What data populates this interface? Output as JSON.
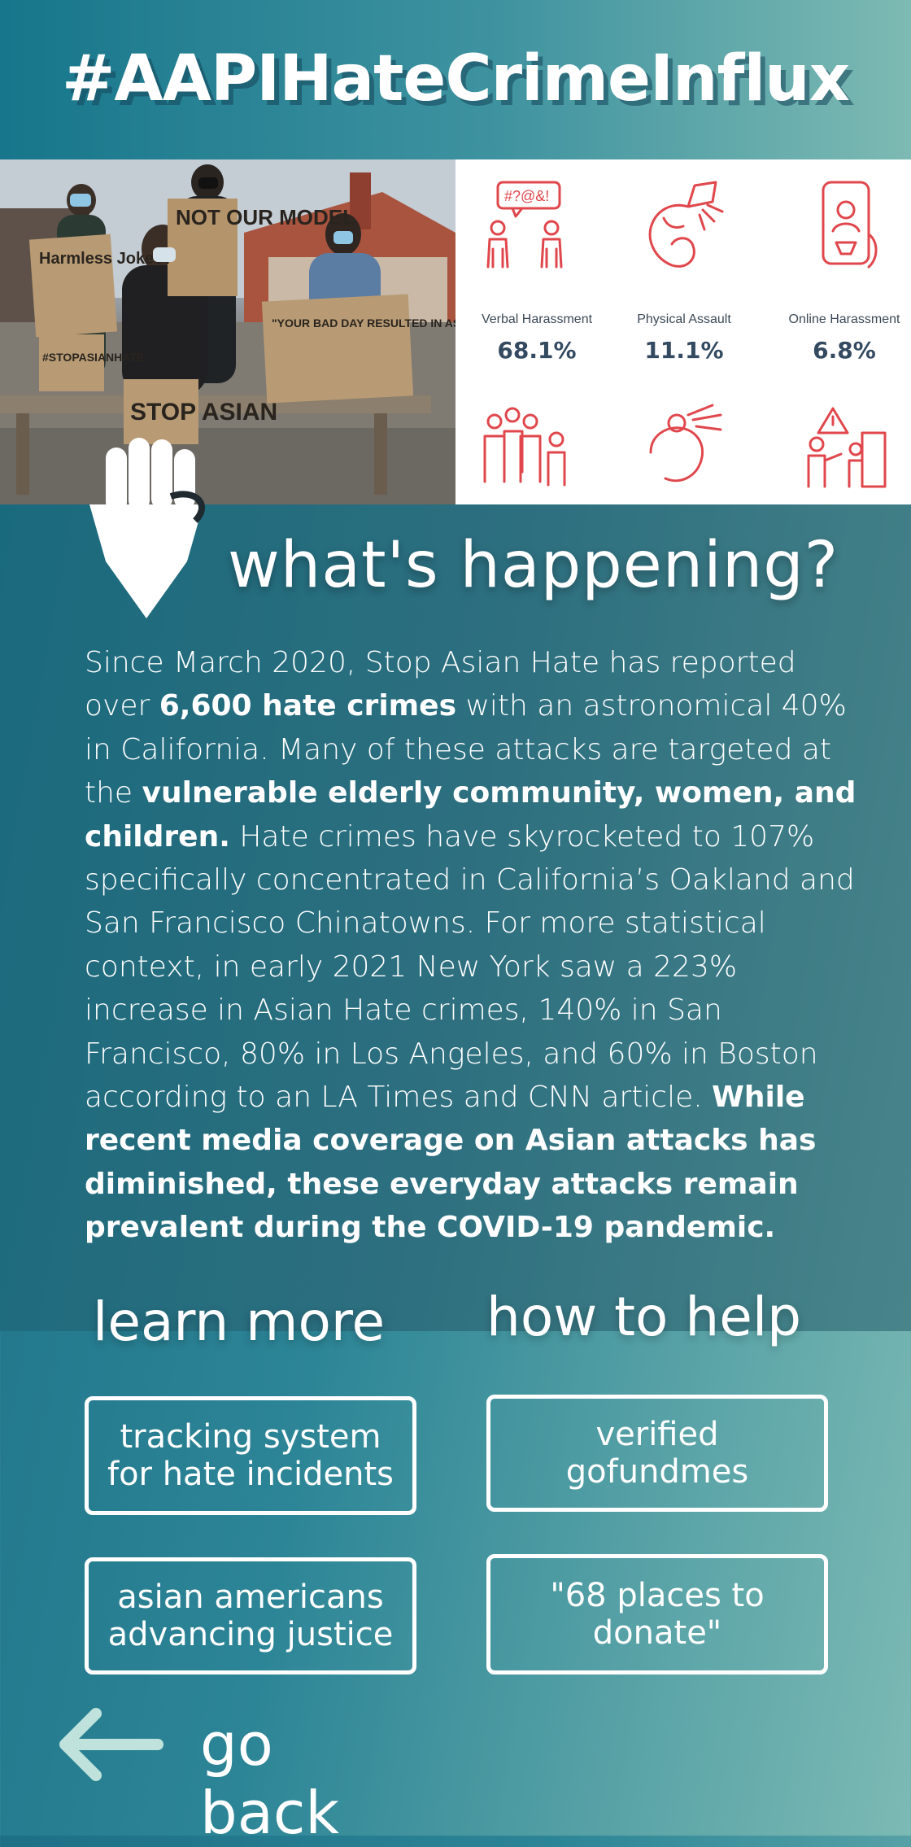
{
  "header": {
    "title": "#AAPIHateCrimeInflux"
  },
  "photo": {
    "signs": [
      "Harmless Jokes?",
      "NOT OUR MODEL",
      "\"YOUR BAD DAY RESULTED IN ASIAN WOMEN BEING MURDERED\"",
      "STOP ASIAN",
      "#STOPASIANHATE"
    ]
  },
  "stats": [
    {
      "label": "Verbal Harassment",
      "value": "68.1%",
      "icon": "verbal-harassment-icon"
    },
    {
      "label": "Physical Assault",
      "value": "11.1%",
      "icon": "physical-assault-icon"
    },
    {
      "label": "Online Harassment",
      "value": "6.8%",
      "icon": "online-harassment-icon"
    }
  ],
  "bottom_icons": [
    "shunning-icon",
    "coughing-icon",
    "workplace-discrimination-icon"
  ],
  "main": {
    "heading": "what's happening?",
    "p1": "Since March 2020, Stop Asian Hate has reported over ",
    "b1": "6,600 hate crimes",
    "p2": " with an astronomical 40% in California. Many of these attacks are targeted at the ",
    "b2": "vulnerable elderly community, women, and children.",
    "p3": " Hate crimes have skyrocketed to 107% specifically concentrated in California’s Oakland and San Francisco Chinatowns. For more statistical context, in early 2021 New York saw a 223% increase in Asian Hate crimes, 140% in San Francisco, 80% in Los Angeles, and 60% in Boston according to an LA Times and CNN article. ",
    "b3": "While recent media coverage on Asian attacks has diminished, these everyday attacks remain prevalent during the COVID-19 pandemic."
  },
  "learn_more": {
    "heading": "learn more",
    "links": [
      {
        "line1": "tracking system",
        "line2": "for hate incidents"
      },
      {
        "line1": "asian americans",
        "line2": "advancing justice"
      }
    ]
  },
  "how_to_help": {
    "heading": "how to help",
    "links": [
      {
        "line1": "verified",
        "line2": "gofundmes"
      },
      {
        "line1": "\"68 places to",
        "line2": "donate\""
      }
    ]
  },
  "back": {
    "label": "go back"
  },
  "colors": {
    "accent_red": "#e0474c",
    "teal_dark": "#1a6a7d",
    "teal_light": "#7cbab4"
  }
}
